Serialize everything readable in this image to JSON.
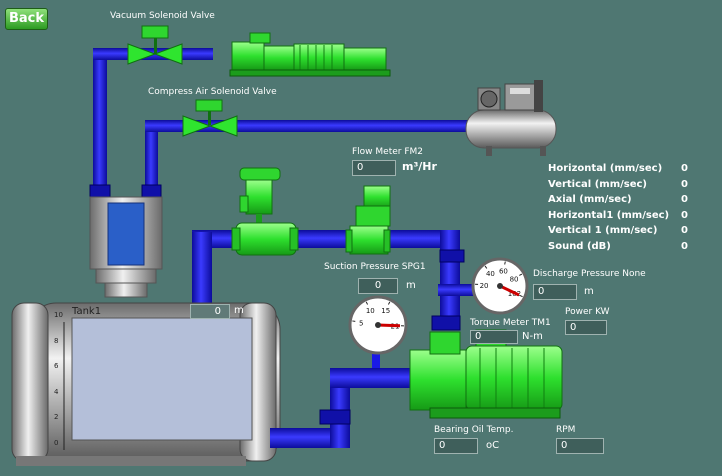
{
  "back_label": "Back",
  "valves": {
    "vacuum": "Vacuum Solenoid  Valve",
    "compress": "Compress Air Solenoid  Valve"
  },
  "flow_meter": {
    "label": "Flow Meter FM2",
    "value": "0",
    "unit": "m³/Hr"
  },
  "suction": {
    "label": "Suction Pressure SPG1",
    "value": "0",
    "unit": "m"
  },
  "discharge": {
    "label": "Discharge Pressure None",
    "value": "0",
    "unit": "m"
  },
  "torque": {
    "label": "Torque Meter TM1",
    "value": "0",
    "unit": "N-m"
  },
  "power": {
    "label": "Power KW",
    "value": "0"
  },
  "bearing": {
    "label": "Bearing Oil Temp.",
    "value": "0",
    "unit": "oC"
  },
  "rpm": {
    "label": "RPM",
    "value": "0"
  },
  "tank": {
    "label": "Tank1",
    "value": "0",
    "unit": "m",
    "level_fraction": 0,
    "scale": [
      "10",
      "8",
      "6",
      "4",
      "2",
      "0"
    ]
  },
  "vibration": [
    {
      "label": "Horizontal  (mm/sec)",
      "value": "0"
    },
    {
      "label": "Vertical (mm/sec)",
      "value": "0"
    },
    {
      "label": "Axial (mm/sec)",
      "value": "0"
    },
    {
      "label": "Horizontal1 (mm/sec)",
      "value": "0"
    },
    {
      "label": "Vertical 1 (mm/sec)",
      "value": "0"
    },
    {
      "label": "Sound (dB)",
      "value": "0"
    }
  ],
  "gauge_suction": {
    "ticks": [
      "5",
      "10",
      "15",
      "21"
    ],
    "reading": 21,
    "min": 0,
    "max": 25
  },
  "gauge_discharge": {
    "ticks": [
      "20",
      "40",
      "60",
      "80",
      "102"
    ],
    "reading": 102,
    "min": 0,
    "max": 110
  },
  "colors": {
    "pipe": "#1a1ae6",
    "equipment": "#33ee33",
    "background": "#4f7772",
    "needle": "#cc0000"
  }
}
